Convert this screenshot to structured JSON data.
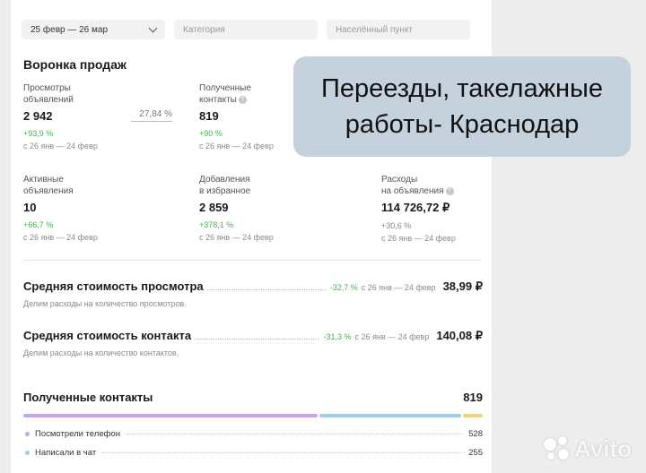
{
  "filters": {
    "date_range": "25 февр — 26 мар",
    "category_placeholder": "Категория",
    "city_placeholder": "Населённый пункт"
  },
  "funnel": {
    "title": "Воронка продаж",
    "conversion": "27,84 %",
    "metrics": [
      {
        "label_1": "Просмотры",
        "label_2": "объявлений",
        "value": "2 942",
        "change": "+93,9 %",
        "period": "с 26 янв — 24 февр"
      },
      {
        "label_1": "Полученные",
        "label_2": "контакты",
        "value": "819",
        "change": "+90 %",
        "period": "с 26 янв — 24 февр"
      },
      {
        "label_1": "Активные",
        "label_2": "объявления",
        "value": "10",
        "change": "+66,7 %",
        "period": "с 26 янв — 24 февр"
      },
      {
        "label_1": "Добавления",
        "label_2": "в избранное",
        "value": "2 859",
        "change": "+378,1 %",
        "period": "с 26 янв — 24 февр"
      },
      {
        "label_1": "Расходы",
        "label_2": "на объявления",
        "value": "114 726,72 ₽",
        "change": "+30,6 %",
        "period": "с 26 янв — 24 февр"
      }
    ]
  },
  "costs": [
    {
      "name": "Средняя стоимость просмотра",
      "change": "-32,7 %",
      "period": "с 26 янв — 24 февр",
      "price": "38,99 ₽",
      "hint": "Делим расходы на количество просмотров."
    },
    {
      "name": "Средняя стоимость контакта",
      "change": "-31,3 %",
      "period": "с 26 янв — 24 февр",
      "price": "140,08 ₽",
      "hint": "Делим расходы на количество контактов."
    }
  ],
  "contacts": {
    "title": "Полученные контакты",
    "total": "819",
    "rows": [
      {
        "label": "Посмотрели телефон",
        "value": "528",
        "color": "#c8a8e8"
      },
      {
        "label": "Написали в чат",
        "value": "255",
        "color": "#9ecde8"
      }
    ],
    "bar_shares": [
      {
        "share": 0.645,
        "color": "#c8a8e8"
      },
      {
        "share": 0.311,
        "color": "#9ecde8"
      },
      {
        "share": 0.044,
        "color": "#f2d27a"
      }
    ]
  },
  "banner": {
    "line1": "Переезды, такелажные",
    "line2": "работы- Краснодар"
  },
  "watermark": {
    "text": "Avito"
  }
}
